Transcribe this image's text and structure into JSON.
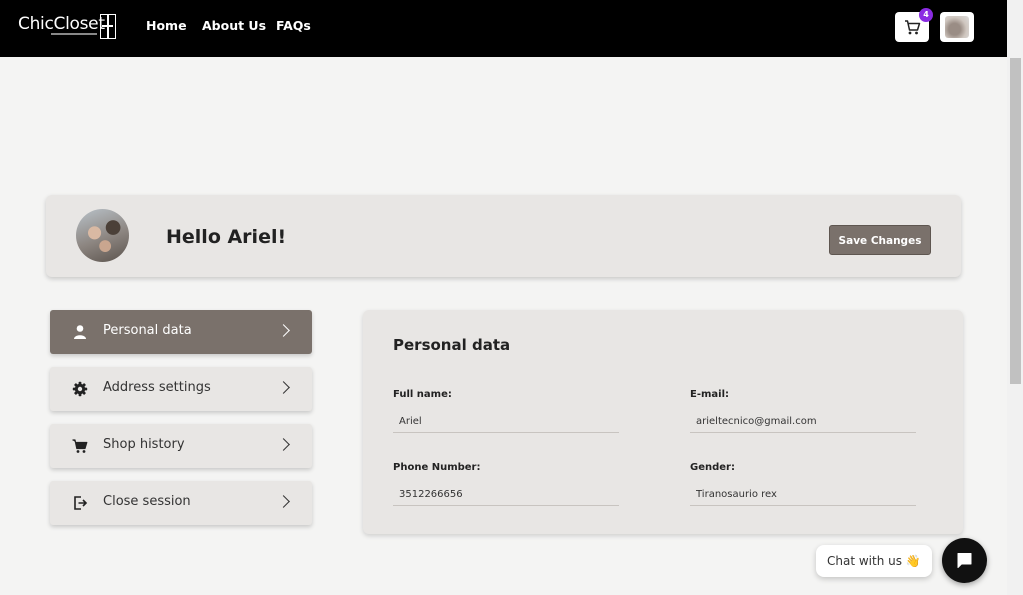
{
  "navbar": {
    "logo_text": "ChicCloset",
    "links": [
      "Home",
      "About Us",
      "FAQs"
    ],
    "cart_count": "4"
  },
  "header": {
    "greeting": "Hello Ariel!",
    "save_label": "Save Changes"
  },
  "menu": {
    "items": [
      {
        "label": "Personal data",
        "icon": "person-icon",
        "active": true
      },
      {
        "label": "Address settings",
        "icon": "gear-icon",
        "active": false
      },
      {
        "label": "Shop history",
        "icon": "cart-icon",
        "active": false
      },
      {
        "label": "Close session",
        "icon": "logout-icon",
        "active": false
      }
    ]
  },
  "personal_data": {
    "title": "Personal data",
    "fields": [
      {
        "label": "Full name:",
        "value": "Ariel"
      },
      {
        "label": "E-mail:",
        "value": "arieltecnico@gmail.com"
      },
      {
        "label": "Phone Number:",
        "value": "3512266656"
      },
      {
        "label": "Gender:",
        "value": "Tiranosaurio rex"
      }
    ]
  },
  "chat": {
    "bubble_text": "Chat with us 👋"
  },
  "colors": {
    "navbar": "#000000",
    "accent": "#7a716b",
    "card": "#e8e6e4",
    "page": "#f4f4f3",
    "badge": "#8a2be2"
  }
}
